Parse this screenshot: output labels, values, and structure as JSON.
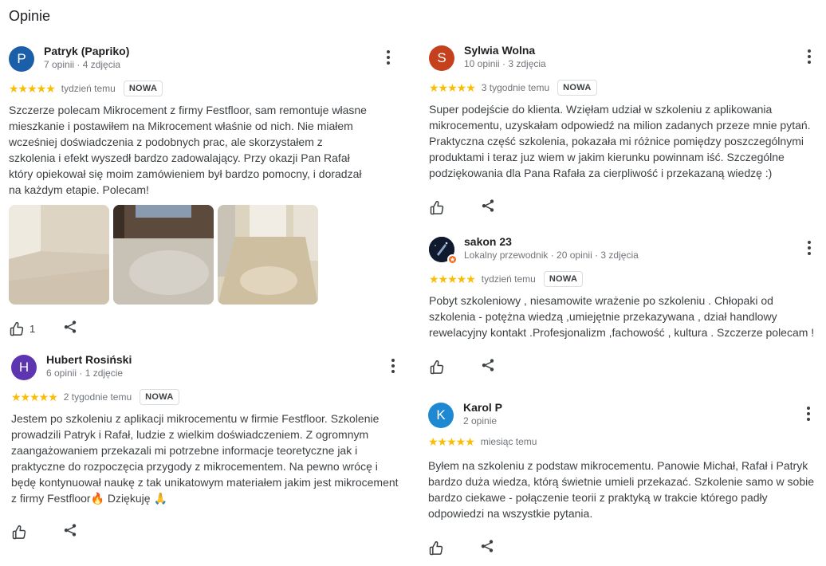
{
  "page": {
    "title": "Opinie"
  },
  "icons": {
    "like": "thumb-up-icon",
    "share": "share-icon",
    "more": "more-vert-icon",
    "star": "star-icon",
    "guide": "local-guide-icon"
  },
  "colors": {
    "star": "#fbbc04",
    "avatar_blue": "#1a5fa8",
    "avatar_red": "#c5401d",
    "avatar_purple": "#5e35b1",
    "avatar_lightblue": "#1e88d3",
    "guide_badge": "#f26b1d"
  },
  "reviews": [
    {
      "avatar_letter": "P",
      "author": "Patryk (Papriko)",
      "meta": "7 opinii · 4 zdjęcia",
      "rating": 5,
      "stars": "★★★★★",
      "time": "tydzień temu",
      "badge": "NOWA",
      "text": "Szczerze polecam Mikrocement z firmy Festfloor, sam remontuje własne mieszkanie i postawiłem na Mikrocement właśnie od nich. Nie miałem wcześniej doświadczenia z podobnych prac, ale skorzystałem z szkolenia i efekt wyszedł bardzo zadowalający. Przy okazji Pan Rafał który opiekował się moim zamówieniem był bardzo pomocny, i doradzał na każdym etapie. Polecam!",
      "likes": "1"
    },
    {
      "avatar_letter": "H",
      "author": "Hubert Rosiński",
      "meta": "6 opinii · 1 zdjęcie",
      "rating": 5,
      "stars": "★★★★★",
      "time": "2 tygodnie temu",
      "badge": "NOWA",
      "text": "Jestem po szkoleniu z aplikacji mikrocementu w firmie Festfloor. Szkolenie prowadzili Patryk i Rafał, ludzie z wielkim doświadczeniem. Z ogromnym zaangażowaniem przekazali mi potrzebne informacje teoretyczne jak i praktyczne do rozpoczęcia przygody z mikrocementem. Na pewno wrócę i będę kontynuował naukę z tak unikatowym materiałem jakim jest mikrocement z firmy Festfloor🔥 Dziękuję 🙏"
    },
    {
      "avatar_letter": "S",
      "author": "Sylwia Wolna",
      "meta": "10 opinii · 3 zdjęcia",
      "rating": 5,
      "stars": "★★★★★",
      "time": "3 tygodnie temu",
      "badge": "NOWA",
      "text": "Super podejście do klienta. Wzięłam udział w szkoleniu z aplikowania mikrocementu, uzyskałam odpowiedź na milion zadanych przeze mnie pytań. Praktyczna część szkolenia, pokazała mi różnice pomiędzy poszczególnymi produktami i teraz juz wiem w jakim kierunku powinnam iść. Szczególne podziękowania dla Pana Rafała za cierpliwość i przekazaną wiedzę :)"
    },
    {
      "author": "sakon 23",
      "meta": "Lokalny przewodnik · 20 opinii · 3 zdjęcia",
      "rating": 5,
      "stars": "★★★★★",
      "time": "tydzień temu",
      "badge": "NOWA",
      "text": "Pobyt szkoleniowy , niesamowite wrażenie po szkoleniu . Chłopaki od szkolenia - potężna wiedzą ,umiejętnie przekazywana , dział handlowy rewelacyjny kontakt .Profesjonalizm ,fachowość , kultura . Szczerze polecam !"
    },
    {
      "avatar_letter": "K",
      "author": "Karol P",
      "meta": "2 opinie",
      "rating": 5,
      "stars": "★★★★★",
      "time": "miesiąc temu",
      "text": "Byłem na szkoleniu z podstaw mikrocementu. Panowie Michał, Rafał i Patryk bardzo duża wiedza, którą świetnie umieli przekazać. Szkolenie samo w sobie bardzo ciekawe - połączenie teorii z praktyką w trakcie którego padły odpowiedzi na wszystkie pytania."
    }
  ]
}
